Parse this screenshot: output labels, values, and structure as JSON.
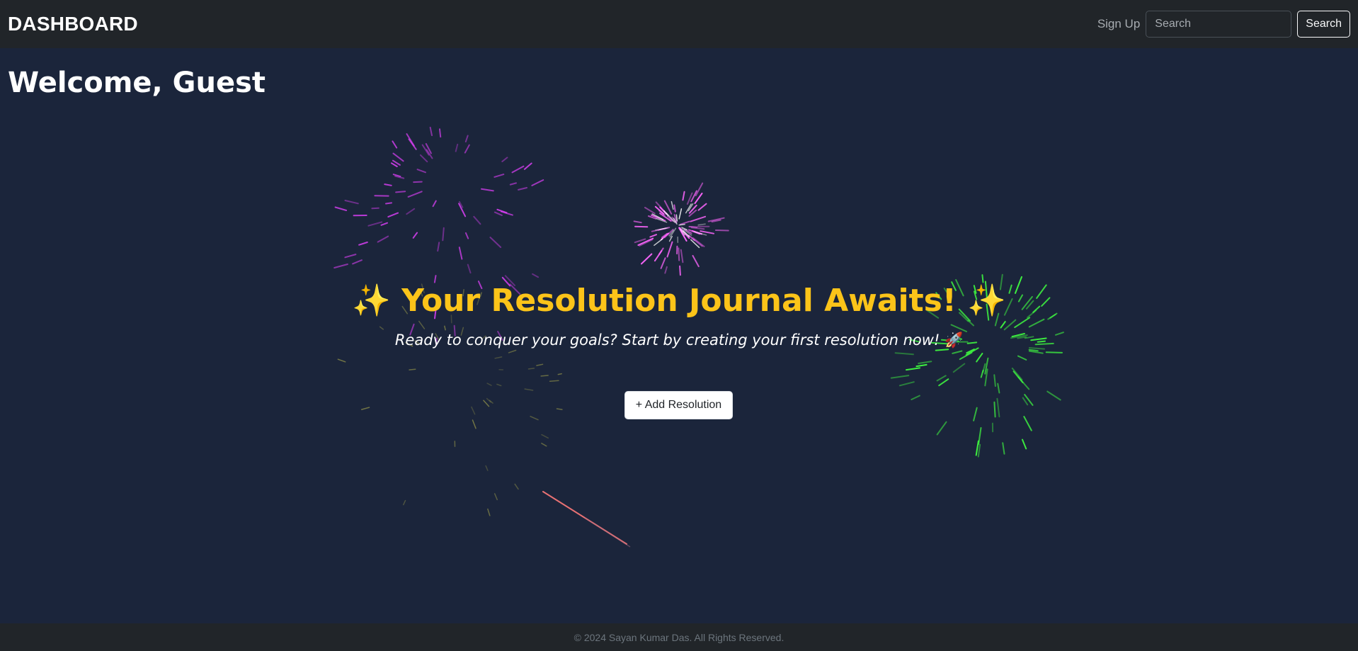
{
  "navbar": {
    "brand": "DASHBOARD",
    "signup_label": "Sign Up",
    "search_placeholder": "Search",
    "search_value": "",
    "search_button_label": "Search"
  },
  "main": {
    "welcome": "Welcome, Guest",
    "hero_sparkle": "✨",
    "hero_title": "Your Resolution Journal Awaits!",
    "hero_subtitle": "Ready to conquer your goals? Start by creating your first resolution now!",
    "hero_subtitle_emoji": "🚀",
    "add_button_label": "+ Add Resolution"
  },
  "footer": {
    "text": "© 2024 Sayan Kumar Das. All Rights Reserved."
  },
  "colors": {
    "background": "#1b253b",
    "navbar": "#212529",
    "accent": "#fcc419",
    "firework_magenta": "#e040fb",
    "firework_pink": "#ff66ff",
    "firework_green": "#40ff40",
    "firework_olive": "#9a9a4a"
  },
  "icons": {
    "sparkle": "sparkle-icon",
    "rocket": "rocket-icon"
  }
}
